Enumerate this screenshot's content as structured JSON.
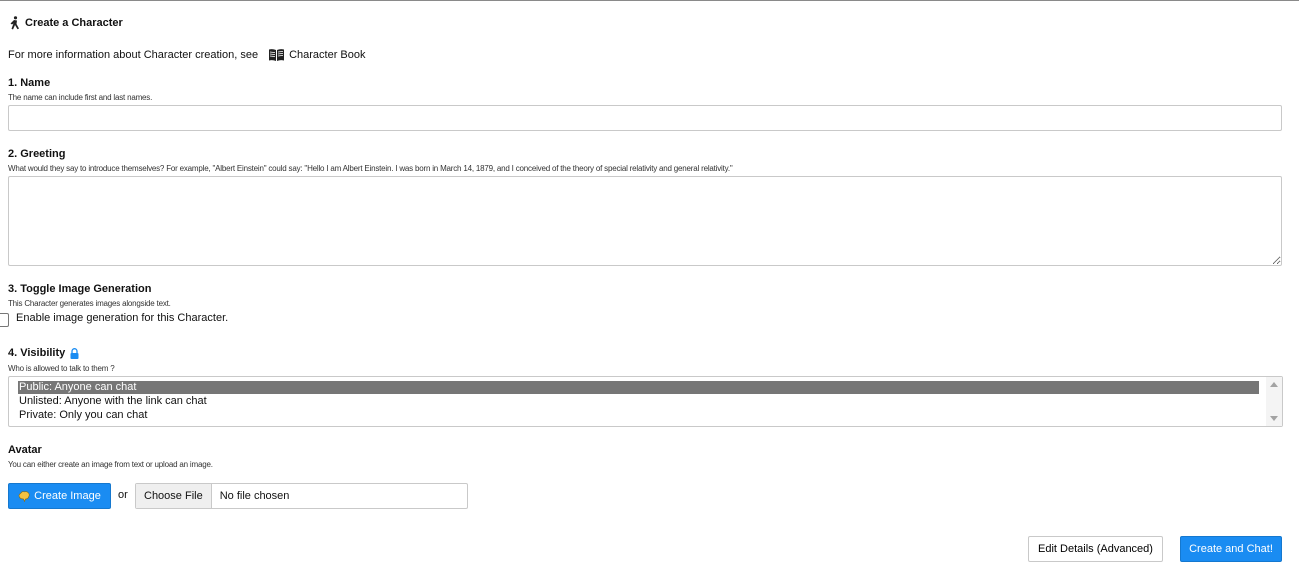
{
  "header": {
    "title": "Create a Character"
  },
  "info": {
    "text": "For more information about Character creation, see",
    "link": "Character Book"
  },
  "name_section": {
    "label": "1. Name",
    "help": "The name can include first and last names.",
    "value": ""
  },
  "greeting_section": {
    "label": "2. Greeting",
    "help": "What would they say to introduce themselves? For example, \"Albert Einstein\" could say: \"Hello I am Albert Einstein. I was born in March 14, 1879, and I conceived of the theory of special relativity and general relativity.\"",
    "value": ""
  },
  "image_gen_section": {
    "label": "3. Toggle Image Generation",
    "help": "This Character generates images alongside text.",
    "checkbox_label": "Enable image generation for this Character.",
    "checked": false
  },
  "visibility_section": {
    "label": "4. Visibility",
    "help": "Who is allowed to talk to them ?",
    "options": [
      "Public: Anyone can chat",
      "Unlisted: Anyone with the link can chat",
      "Private: Only you can chat"
    ],
    "selected": "Public: Anyone can chat"
  },
  "avatar_section": {
    "label": "Avatar",
    "help": "You can either create an image from text or upload an image.",
    "create_button": "Create Image",
    "or": "or",
    "choose_file": "Choose File",
    "no_file": "No file chosen"
  },
  "footer": {
    "edit_details": "Edit Details (Advanced)",
    "create_chat": "Create and Chat!"
  },
  "colors": {
    "primary": "#1a8cf2",
    "selected_option": "#767676",
    "lock": "#1a8cf2"
  },
  "icons": {
    "title": "person-walking-icon",
    "book": "book-open-icon",
    "lock": "lock-icon",
    "create_image": "brain-icon"
  }
}
